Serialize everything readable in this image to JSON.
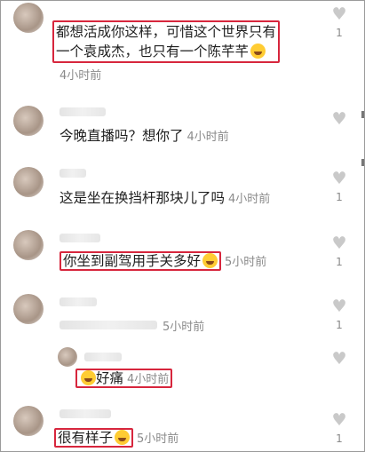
{
  "comments": [
    {
      "text": "都想活成你这样，可惜这个世界只有",
      "text2": "一个袁成杰，也只有一个陈芊芊",
      "time": "4小时前",
      "likes": "1"
    },
    {
      "text": "今晚直播吗？想你了",
      "time": "4小时前"
    },
    {
      "text": "这是坐在换挡杆那块儿了吗",
      "time": "4小时前",
      "likes": "1"
    },
    {
      "text": "你坐到副驾用手关多好",
      "time": "5小时前",
      "likes": "1"
    },
    {
      "time": "5小时前",
      "likes": "1"
    },
    {
      "text": "好痛",
      "time": "4小时前"
    },
    {
      "text": "很有样子",
      "time": "5小时前",
      "likes": "1"
    }
  ],
  "icons": {
    "like": "heart-outline-icon",
    "emoji": "grinning-emoji-icon"
  },
  "colors": {
    "highlight": "#d7263d",
    "muted": "#8a8a8a"
  }
}
